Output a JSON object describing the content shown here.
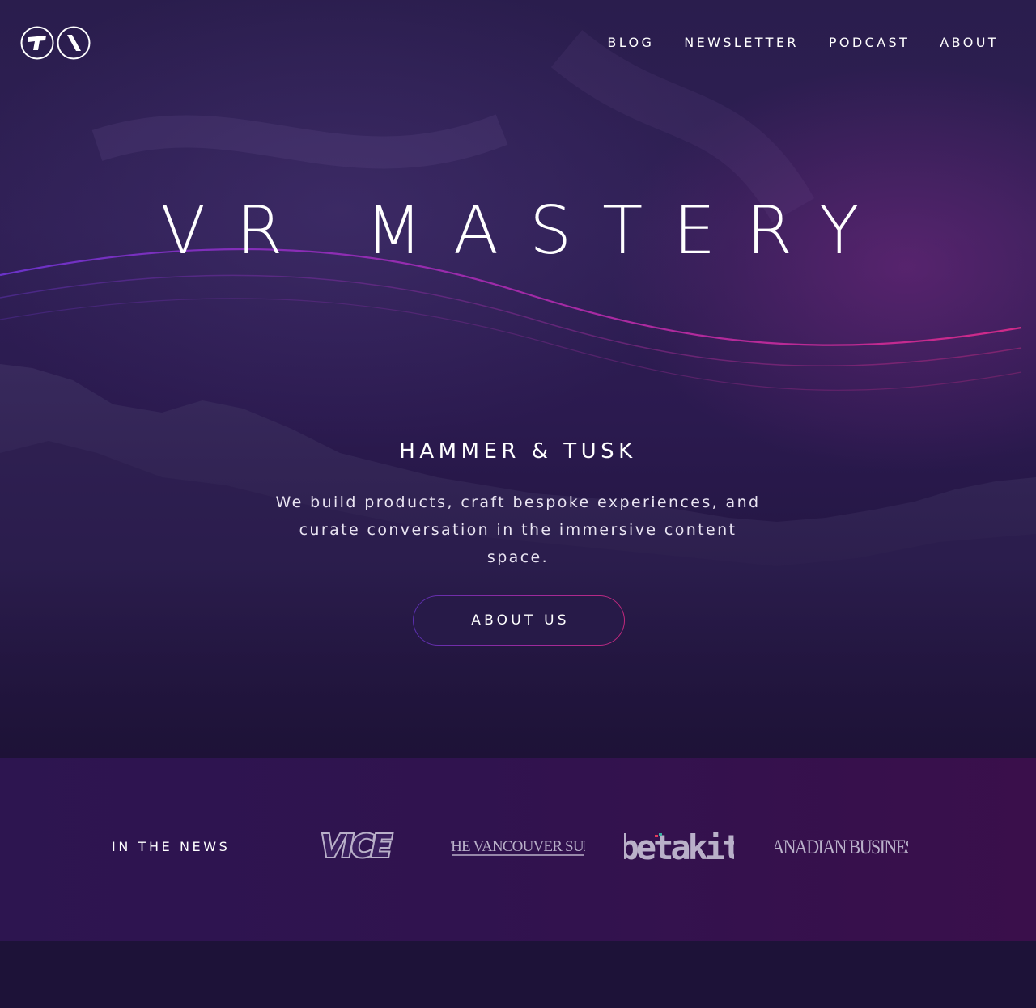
{
  "brand": {
    "logo_icon": "ta-monogram-icon"
  },
  "nav": {
    "items": [
      {
        "label": "BLOG"
      },
      {
        "label": "NEWSLETTER"
      },
      {
        "label": "PODCAST"
      },
      {
        "label": "ABOUT"
      }
    ]
  },
  "hero": {
    "title": "VR MASTERY",
    "brand_name": "HAMMER & TUSK",
    "tagline": "We build products, craft bespoke experiences, and curate conversation in the immersive content space.",
    "cta_label": "ABOUT US"
  },
  "news": {
    "label": "IN THE NEWS",
    "logos": [
      {
        "name": "VICE"
      },
      {
        "name": "THE VANCOUVER SUN"
      },
      {
        "name": "betakit"
      },
      {
        "name": "CANADIAN BUSINESS"
      }
    ]
  },
  "colors": {
    "background": "#1c1236",
    "hero_purple": "#2f1f55",
    "accent_magenta": "#c2287c",
    "accent_violet": "#5a2fb0",
    "news_band": "#30134f",
    "logo_grey": "#b9b0c9"
  }
}
